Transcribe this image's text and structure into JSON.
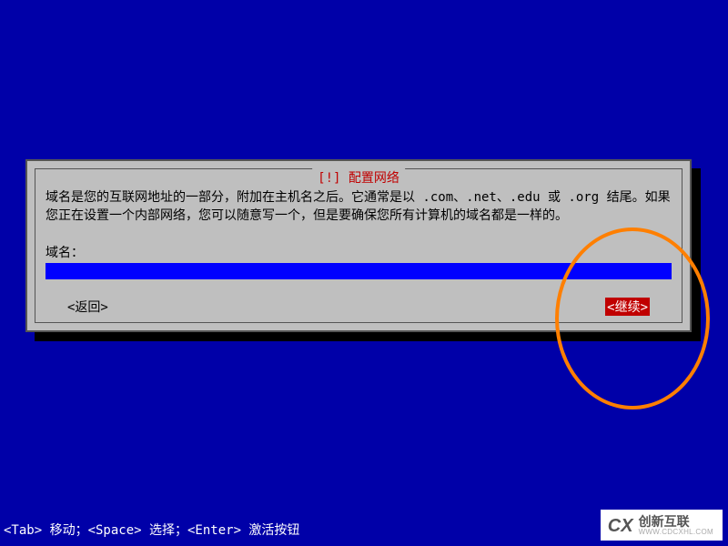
{
  "dialog": {
    "title": "[!] 配置网络",
    "description": "域名是您的互联网地址的一部分，附加在主机名之后。它通常是以 .com、.net、.edu 或 .org 结尾。如果您正在设置一个内部网络，您可以随意写一个，但是要确保您所有计算机的域名都是一样的。",
    "field_label": "域名：",
    "input_value": "",
    "back_label": "<返回>",
    "continue_label": "<继续>"
  },
  "footer": {
    "hint": "<Tab> 移动；<Space> 选择；<Enter> 激活按钮"
  },
  "watermark": {
    "name": "创新互联",
    "url": "WWW.CDCXHL.COM"
  },
  "annotation": {
    "color": "#ff7f00"
  }
}
